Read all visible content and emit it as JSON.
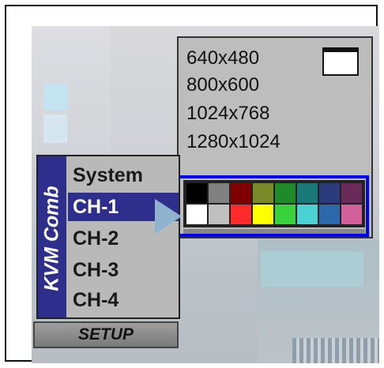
{
  "resolution_menu": {
    "options": [
      "640x480",
      "800x600",
      "1024x768",
      "1280x1024"
    ]
  },
  "color_palette": {
    "row1": [
      "#000000",
      "#808080",
      "#800000",
      "#7a8a2a",
      "#1e8a2a",
      "#1a7a7a",
      "#2a3a7a",
      "#6a2a5a"
    ],
    "row2": [
      "#ffffff",
      "#c0c0c0",
      "#ff2a2a",
      "#ffff00",
      "#3ad23a",
      "#4ad2d2",
      "#2a6aaa",
      "#d2609a"
    ]
  },
  "kvm_menu": {
    "title": "KVM Comb",
    "items": [
      "System",
      "CH-1",
      "CH-2",
      "CH-3",
      "CH-4"
    ],
    "selected": "CH-1"
  },
  "setup_button": {
    "label": "SETUP"
  },
  "colors": {
    "menu_blue": "#2e2e8c",
    "highlight": "#0000ff"
  }
}
